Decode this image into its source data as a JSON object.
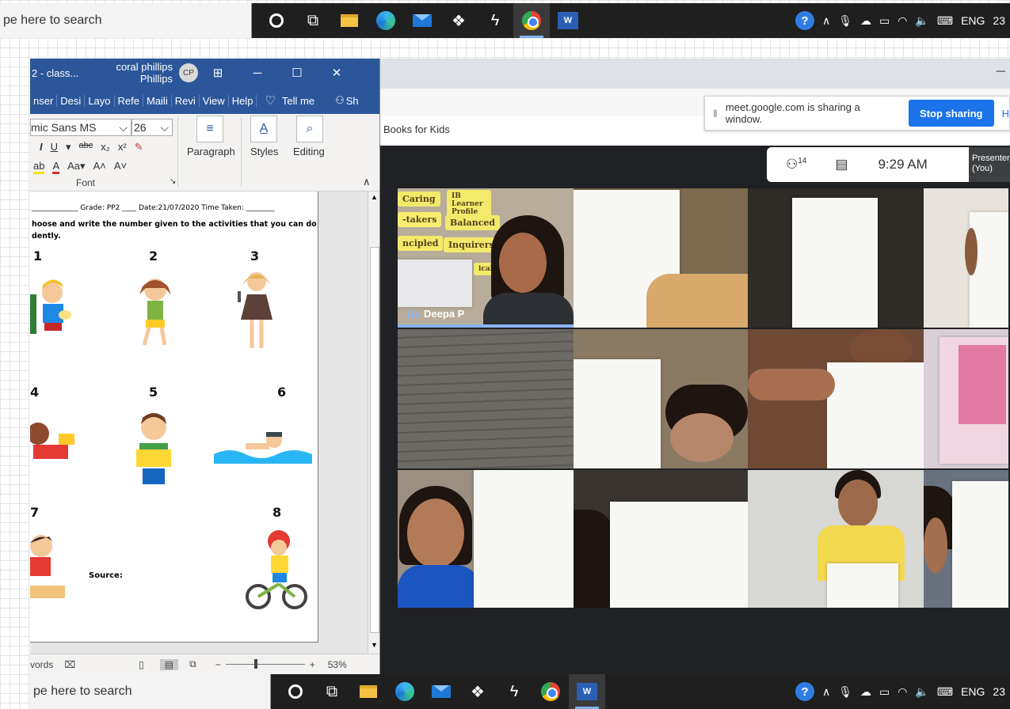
{
  "taskbar": {
    "search_text": "pe here to search",
    "language": "ENG",
    "clock_partial": "23",
    "help_icon": "?",
    "word_icon_letter": "W",
    "icons": [
      "cortana-icon",
      "task-view-icon",
      "file-explorer-icon",
      "edge-icon",
      "mail-icon",
      "dropbox-icon",
      "lightning-icon",
      "chrome-icon",
      "word-icon"
    ]
  },
  "word": {
    "doc_title": "2 - class...",
    "user_name": "coral phillips Phillips",
    "user_initials": "CP",
    "tabs": [
      "nser",
      "Desi",
      "Layo",
      "Refe",
      "Maili",
      "Revi",
      "View",
      "Help"
    ],
    "tell_me": "Tell me",
    "share": "Sh",
    "font_name": "mic Sans MS",
    "font_size": "26",
    "groups": {
      "paragraph": "Paragraph",
      "styles": "Styles",
      "editing": "Editing",
      "font": "Font"
    },
    "worksheet": {
      "header": "_____________  Grade: PP2 ____  Date:21/07/2020 Time Taken: ________",
      "instructions": "hoose and write the number given to the activities that you can do\ndently.",
      "numbers": [
        "1",
        "2",
        "3",
        "4",
        "5",
        "6",
        "7",
        "8"
      ],
      "source_label": "Source:"
    },
    "status": {
      "words": "vords",
      "zoom": "53%",
      "minus": "−",
      "plus": "+"
    }
  },
  "chrome": {
    "bookmark_label": "Books for Kids",
    "share_message": "meet.google.com is sharing a window.",
    "stop_sharing": "Stop sharing",
    "hide_partial": "H"
  },
  "meet": {
    "participants_count": "14",
    "time": "9:29 AM",
    "presenter_line1": "Presenter",
    "presenter_line2": "(You)",
    "speaker_name": "Deepa P",
    "wall_labels": [
      "Caring",
      "IB Learner Profile",
      "-takers",
      "Balanced",
      "ncipled",
      "Inquirers",
      "icable"
    ],
    "colors": {
      "meet_bg": "#202124",
      "accent": "#8ab4f8",
      "stop_button": "#1a73e8",
      "word_blue": "#2b579a"
    }
  }
}
